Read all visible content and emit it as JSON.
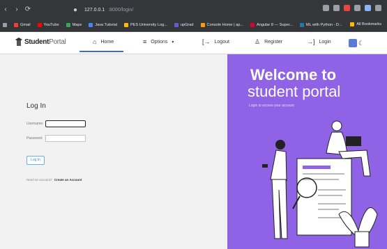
{
  "browser": {
    "url_host": "127.0.0.1",
    "url_path": ":8000/login/",
    "bookmarks": [
      {
        "label": "Gmail",
        "color": "#ea4335"
      },
      {
        "label": "YouTube",
        "color": "#ff0000"
      },
      {
        "label": "Maps",
        "color": "#34a853"
      },
      {
        "label": "Java Tutorial",
        "color": "#4285f4"
      },
      {
        "label": "PES University Log...",
        "color": "#fbbc05"
      },
      {
        "label": "upGrad",
        "color": "#6a5acd"
      },
      {
        "label": "Console Home | ap...",
        "color": "#ff9900"
      },
      {
        "label": "Angular 8 — Super...",
        "color": "#dd0031"
      },
      {
        "label": "ML with Python - D...",
        "color": "#1f77b4"
      }
    ],
    "all_bookmarks": "All Bookmarks"
  },
  "nav": {
    "logo": "Student",
    "logo_suffix": "Portal",
    "home": "Home",
    "options": "Options",
    "logout": "Logout",
    "register": "Register",
    "login": "Login"
  },
  "login": {
    "title": "Log In",
    "username_label": "Username:",
    "password_label": "Password:",
    "button": "Log In",
    "signup_prompt": "Need an account?",
    "signup_link": "Create an Account"
  },
  "hero": {
    "title_line1": "Welcome to",
    "title_line2": "student portal",
    "subtitle": "Login to access your account"
  },
  "colors": {
    "hero_bg": "#8f62e6",
    "nav_accent": "#3c6ad6",
    "chrome_bg": "#35363a"
  }
}
